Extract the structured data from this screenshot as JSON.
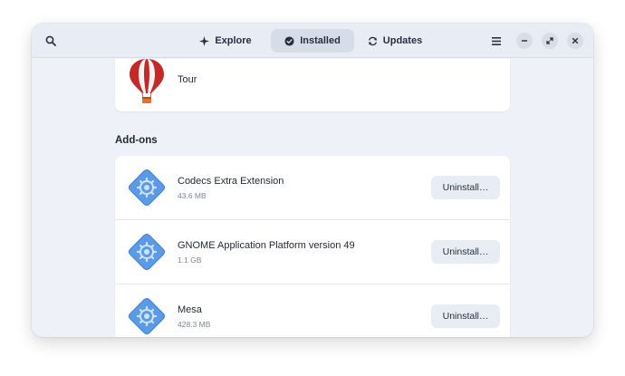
{
  "header": {
    "tabs": [
      {
        "label": "Explore",
        "icon": "sparkle-icon"
      },
      {
        "label": "Installed",
        "icon": "check-circle-icon",
        "active": true
      },
      {
        "label": "Updates",
        "icon": "refresh-icon"
      }
    ]
  },
  "apps": {
    "tour": {
      "name": "Tour",
      "icon": "hot-air-balloon-icon"
    }
  },
  "addons": {
    "section_title": "Add-ons",
    "items": [
      {
        "name": "Codecs Extra Extension",
        "size": "43.6 MB",
        "button": "Uninstall…"
      },
      {
        "name": "GNOME Application Platform version 49",
        "size": "1.1 GB",
        "button": "Uninstall…"
      },
      {
        "name": "Mesa",
        "size": "428.3 MB",
        "button": "Uninstall…"
      }
    ]
  },
  "colors": {
    "window_bg": "#eef2f8",
    "headerbar_bg": "#e8edf5",
    "addon_icon_blue": "#5b9ae6",
    "balloon_red": "#c62828",
    "balloon_basket": "#e8712a"
  }
}
